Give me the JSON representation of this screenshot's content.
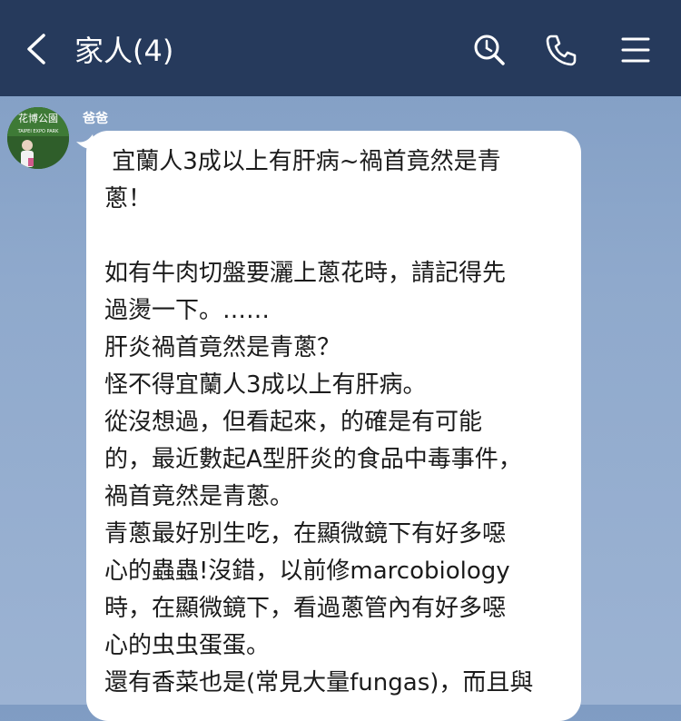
{
  "header": {
    "title": "家人(4)",
    "icons": {
      "back": "back-chevron-icon",
      "search": "search-icon",
      "call": "phone-icon",
      "menu": "menu-icon"
    }
  },
  "message": {
    "sender": "爸爸",
    "avatar_text": "花博公園",
    "avatar_subtext": "TAIPEI EXPO PARK",
    "text": " 宜蘭人3成以上有肝病~禍首竟然是青\n蔥！\n\n如有牛肉切盤要灑上蔥花時，請記得先\n過燙一下。……\n肝炎禍首竟然是青蔥？\n怪不得宜蘭人3成以上有肝病。\n從沒想過，但看起來，的確是有可能\n的，最近數起A型肝炎的食品中毒事件，\n禍首竟然是青蔥。\n青蔥最好別生吃，在顯微鏡下有好多噁\n心的蟲蟲!沒錯，以前修marcobiology\n時，在顯微鏡下，看過蔥管內有好多噁\n心的虫虫蛋蛋。\n還有香菜也是(常見大量fungas)，而且與"
  },
  "colors": {
    "header_bg": "#263a5c",
    "chat_bg": "#8fa9cc",
    "bubble_bg": "#ffffff"
  }
}
